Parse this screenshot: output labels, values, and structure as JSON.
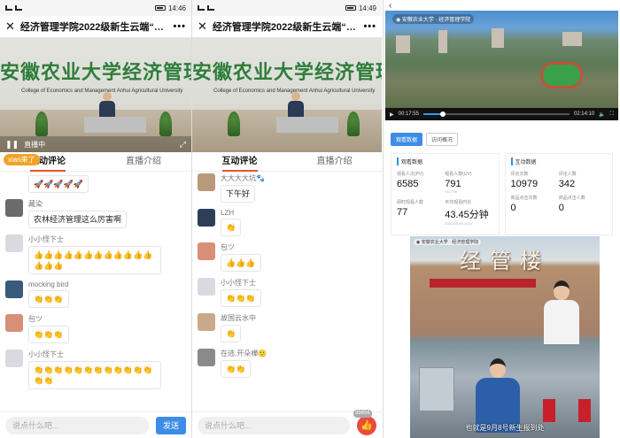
{
  "panel1": {
    "status_time": "14:46",
    "title": "经济管理学院2022级新生云端“秋日...",
    "live_label": "直播中",
    "name_tag": "xian来了",
    "tabs": [
      "互动评论",
      "直播介绍"
    ],
    "comments": [
      {
        "name": "",
        "text": "🚀🚀🚀🚀🚀",
        "avatar_color": "#ffffff"
      },
      {
        "name": "藏染",
        "text": "农林经济管理这么厉害啊",
        "avatar_color": "#6b6b6b"
      },
      {
        "name": "小小怪下士",
        "text": "👍👍👍👍👍👍👍👍👍👍👍👍👍👍👍",
        "avatar_color": "#d9dadf"
      },
      {
        "name": "mocking bird",
        "text": "👏👏👏",
        "avatar_color": "#3a5a7a"
      },
      {
        "name": "包ツ",
        "text": "👏👏👏",
        "avatar_color": "#d88f78"
      },
      {
        "name": "小小怪下士",
        "text": "👏👏👏👏👏👏👏👏👏👏👏👏👏👏",
        "avatar_color": "#d9dadf"
      }
    ],
    "input_placeholder": "说点什么吧...",
    "send_label": "发送"
  },
  "panel2": {
    "status_time": "14:49",
    "title": "经济管理学院2022级新生云端“秋日...",
    "tabs": [
      "互动评论",
      "直播介绍"
    ],
    "comments": [
      {
        "name": "大大大大坑🐾",
        "text": "下午好",
        "avatar_color": "#b89a7a"
      },
      {
        "name": "LZH",
        "text": "👏",
        "avatar_color": "#2f3e57"
      },
      {
        "name": "包ツ",
        "text": "👍👍👍",
        "avatar_color": "#d88f78"
      },
      {
        "name": "小小怪下士",
        "text": "👏👏👏",
        "avatar_color": "#d9dadf"
      },
      {
        "name": "故国云水中",
        "text": "👏",
        "avatar_color": "#c9a98a"
      },
      {
        "name": "在逃.开朵樺🙂",
        "text": "👏👏",
        "avatar_color": "#8a8a8a"
      }
    ],
    "input_placeholder": "说点什么吧...",
    "like_count": "35656"
  },
  "banner": {
    "zh": "安徽农业大学经济管理学院",
    "en": "College of Economics and Management Anhui Agricultural University"
  },
  "panel3": {
    "player": {
      "current_time": "00:17:55",
      "total_time": "02:14:10",
      "progress": 0.134
    },
    "dash_tabs": [
      "观看数据",
      "访问概况"
    ],
    "sections": [
      {
        "title": "观看数据",
        "stats": [
          {
            "label": "观看人次(PV)",
            "value": "6585",
            "sub": ""
          },
          {
            "label": "观看人数(UV)",
            "value": "791",
            "sub": "75.77%"
          },
          {
            "label": "即时观看人数",
            "value": "77",
            "sub": ""
          },
          {
            "label": "平均观看时长",
            "value": "43.45分钟",
            "sub": "2022-09-03 14:57"
          }
        ]
      },
      {
        "title": "互动数据",
        "stats": [
          {
            "label": "评论次数",
            "value": "10979",
            "sub": ""
          },
          {
            "label": "评论人数",
            "value": "342",
            "sub": ""
          },
          {
            "label": "商品点击次数",
            "value": "0",
            "sub": ""
          },
          {
            "label": "商品点击人数",
            "value": "0",
            "sub": ""
          }
        ]
      }
    ],
    "promo": {
      "sign": "经管楼",
      "caption": "也就是9月8号新生报到处"
    }
  }
}
